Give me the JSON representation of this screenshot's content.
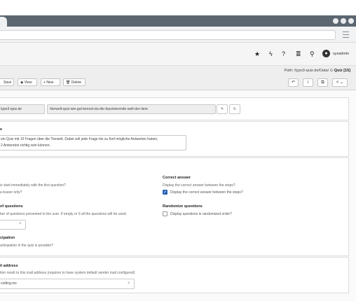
{
  "topbar": {
    "username": "sysadmin"
  },
  "docheader": {
    "path_prefix": "Path: /typo3-quiz.de/Data/",
    "path_page": "Quiz [15]",
    "buttons": {
      "save": "Save",
      "view": "View",
      "new": "New",
      "delete": "Delete"
    }
  },
  "slug": {
    "domain": "typo3-quiz.de",
    "value": "/tierwelt-quiz-wie-gut-kennst-du-die-faszinierende-welt-der-tiere"
  },
  "description": {
    "label_fragment": "e",
    "lines": [
      "ein Quiz mit 10 Fragen über die Tierwelt. Dabei soll jede Frage bis zu fünf mögliche Antworten haben,",
      "2 Antworten richtig sein können."
    ]
  },
  "settings": {
    "start_desc": "iz start immediately with the first question?",
    "teaser_desc": "a teaser only?",
    "correct_answer": {
      "label": "Correct answer",
      "desc": "Display the correct answer between the steps?",
      "checkbox_label": "Display the correct answer between the steps?",
      "checked": true
    },
    "num_questions": {
      "label": "of questions",
      "desc": "ber of questions presented to the user. If empty or 0 all the questions will be used."
    },
    "randomize": {
      "label": "Randomize questions",
      "checkbox_label": "Display questions in randomized order?",
      "checked": false
    },
    "participation": {
      "label": "cipation",
      "desc": "articipation in the quiz is possible?"
    }
  },
  "email": {
    "label": "il address",
    "desc": "tion result to this mail address (requires to have system default sender mail configured)",
    "value": "coding.ms"
  }
}
